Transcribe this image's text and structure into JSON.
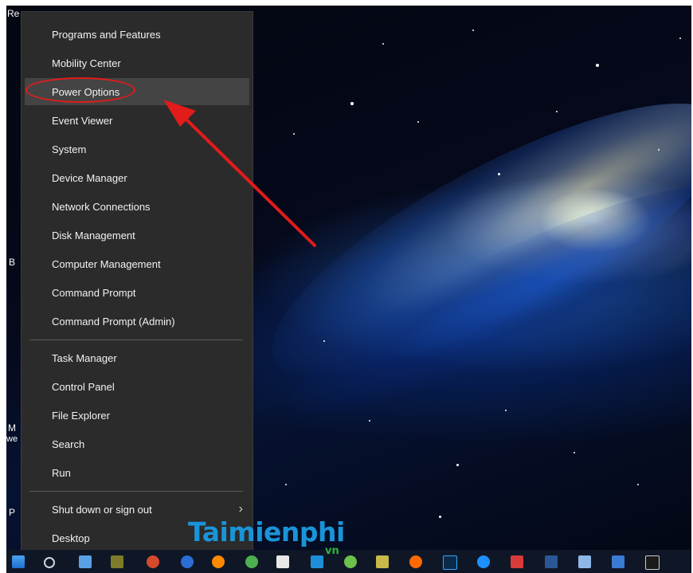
{
  "context_menu": {
    "items": [
      {
        "label": "Programs and Features"
      },
      {
        "label": "Mobility Center"
      },
      {
        "label": "Power Options"
      },
      {
        "label": "Event Viewer"
      },
      {
        "label": "System"
      },
      {
        "label": "Device Manager"
      },
      {
        "label": "Network Connections"
      },
      {
        "label": "Disk Management"
      },
      {
        "label": "Computer Management"
      },
      {
        "label": "Command Prompt"
      },
      {
        "label": "Command Prompt (Admin)"
      },
      {
        "label": "Task Manager"
      },
      {
        "label": "Control Panel"
      },
      {
        "label": "File Explorer"
      },
      {
        "label": "Search"
      },
      {
        "label": "Run"
      },
      {
        "label": "Shut down or sign out"
      },
      {
        "label": "Desktop"
      }
    ],
    "highlighted_item": "Power Options",
    "submenu_chevron": "chevron-right-icon"
  },
  "annotation": {
    "color": "#e21b1b"
  },
  "desktop_fragments": {
    "top_left": "Re",
    "left_b": "B",
    "left_m": "M",
    "left_we": "we",
    "left_p": "P"
  },
  "watermark": {
    "brand": "Taimienphi",
    "suffix": "vn"
  },
  "taskbar": {
    "icons": [
      "start-icon",
      "search-icon",
      "app-icon",
      "app-icon",
      "app-icon",
      "app-icon",
      "app-icon",
      "app-icon",
      "app-icon",
      "app-icon",
      "app-icon",
      "app-icon",
      "firefox-icon",
      "photoshop-icon",
      "app-icon",
      "app-icon",
      "word-icon",
      "app-icon",
      "app-icon",
      "cmd-icon"
    ]
  }
}
